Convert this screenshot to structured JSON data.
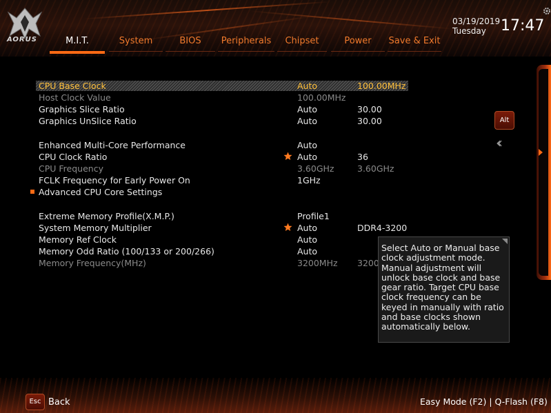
{
  "brand": {
    "logo_text": "AORUS"
  },
  "header": {
    "date": "03/19/2019",
    "day": "Tuesday",
    "time": "17:47"
  },
  "tabs": [
    {
      "label": "M.I.T.",
      "active": true
    },
    {
      "label": "System"
    },
    {
      "label": "BIOS"
    },
    {
      "label": "Peripherals"
    },
    {
      "label": "Chipset"
    },
    {
      "label": "Power"
    },
    {
      "label": "Save & Exit"
    }
  ],
  "settings": [
    {
      "label": "CPU Base Clock",
      "value": "Auto",
      "value2": "100.00MHz",
      "selected": true
    },
    {
      "label": "Host Clock Value",
      "value": "100.00MHz",
      "value2": "",
      "dim": true
    },
    {
      "label": "Graphics Slice Ratio",
      "value": "Auto",
      "value2": "30.00"
    },
    {
      "label": "Graphics UnSlice Ratio",
      "value": "Auto",
      "value2": "30.00"
    },
    {
      "label": "Enhanced Multi-Core Performance",
      "value": "Auto",
      "value2": ""
    },
    {
      "label": "CPU Clock Ratio",
      "value": "Auto",
      "value2": "36",
      "star": true
    },
    {
      "label": "CPU Frequency",
      "value": "3.60GHz",
      "value2": "3.60GHz",
      "dim": true
    },
    {
      "label": "FCLK Frequency for Early Power On",
      "value": "1GHz",
      "value2": ""
    },
    {
      "label": "Advanced CPU Core Settings",
      "value": "",
      "value2": "",
      "submenu": true
    },
    {
      "label": "Extreme Memory Profile(X.M.P.)",
      "value": "Profile1",
      "value2": ""
    },
    {
      "label": "System Memory Multiplier",
      "value": "Auto",
      "value2": "DDR4-3200",
      "star": true
    },
    {
      "label": "Memory Ref Clock",
      "value": "Auto",
      "value2": ""
    },
    {
      "label": "Memory Odd Ratio (100/133 or 200/266)",
      "value": "Auto",
      "value2": ""
    },
    {
      "label": "Memory Frequency(MHz)",
      "value": "3200MHz",
      "value2": "3200",
      "dim": true
    }
  ],
  "help_text": "Select Auto or Manual base clock adjustment mode. Manual adjustment will unlock base clock and base gear ratio. Target CPU base clock frequency can be keyed in manually with ratio and base clocks shown automatically below.",
  "alt_key": "Alt",
  "footer": {
    "esc_key": "Esc",
    "back_label": "Back",
    "right_text": "Easy Mode (F2)  |  Q-Flash (F8)"
  },
  "colors": {
    "accent": "#ff6a14",
    "tab_text": "#f07a2c",
    "highlight_text": "#ffc03c"
  },
  "icons": [
    "aorus-logo-icon",
    "gear-icon",
    "star-icon",
    "double-chevron-left-icon",
    "side-arrow-icon"
  ]
}
